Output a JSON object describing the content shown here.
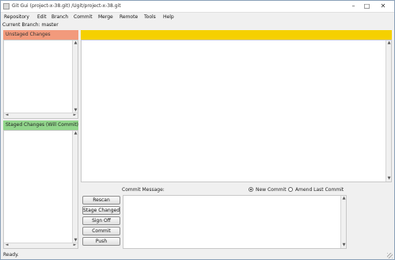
{
  "window": {
    "title": "Git Gui (project-x-38.git) /Ugit/project-x-38.git",
    "controls": {
      "minimize": "–",
      "maximize": "□",
      "close": "✕"
    }
  },
  "menubar": {
    "items": [
      "Repository",
      "Edit",
      "Branch",
      "Commit",
      "Merge",
      "Remote",
      "Tools",
      "Help"
    ]
  },
  "branch": {
    "label": "Current Branch: master"
  },
  "unstaged": {
    "header": "Unstaged Changes"
  },
  "staged": {
    "header": "Staged Changes (Will Commit)"
  },
  "commit": {
    "message_label": "Commit Message:",
    "new_commit_label": "New Commit",
    "amend_label": "Amend Last Commit",
    "new_commit_selected": true
  },
  "buttons": {
    "rescan": "Rescan",
    "stage_changed": "Stage Changed",
    "sign_off": "Sign Off",
    "commit": "Commit",
    "push": "Push"
  },
  "status": {
    "text": "Ready."
  },
  "icons": {
    "scroll_up": "▲",
    "scroll_down": "▼",
    "scroll_left": "◄",
    "scroll_right": "►"
  },
  "colors": {
    "unstaged_header": "#f29a7c",
    "staged_header": "#92d68c",
    "diff_header": "#f5d000"
  }
}
